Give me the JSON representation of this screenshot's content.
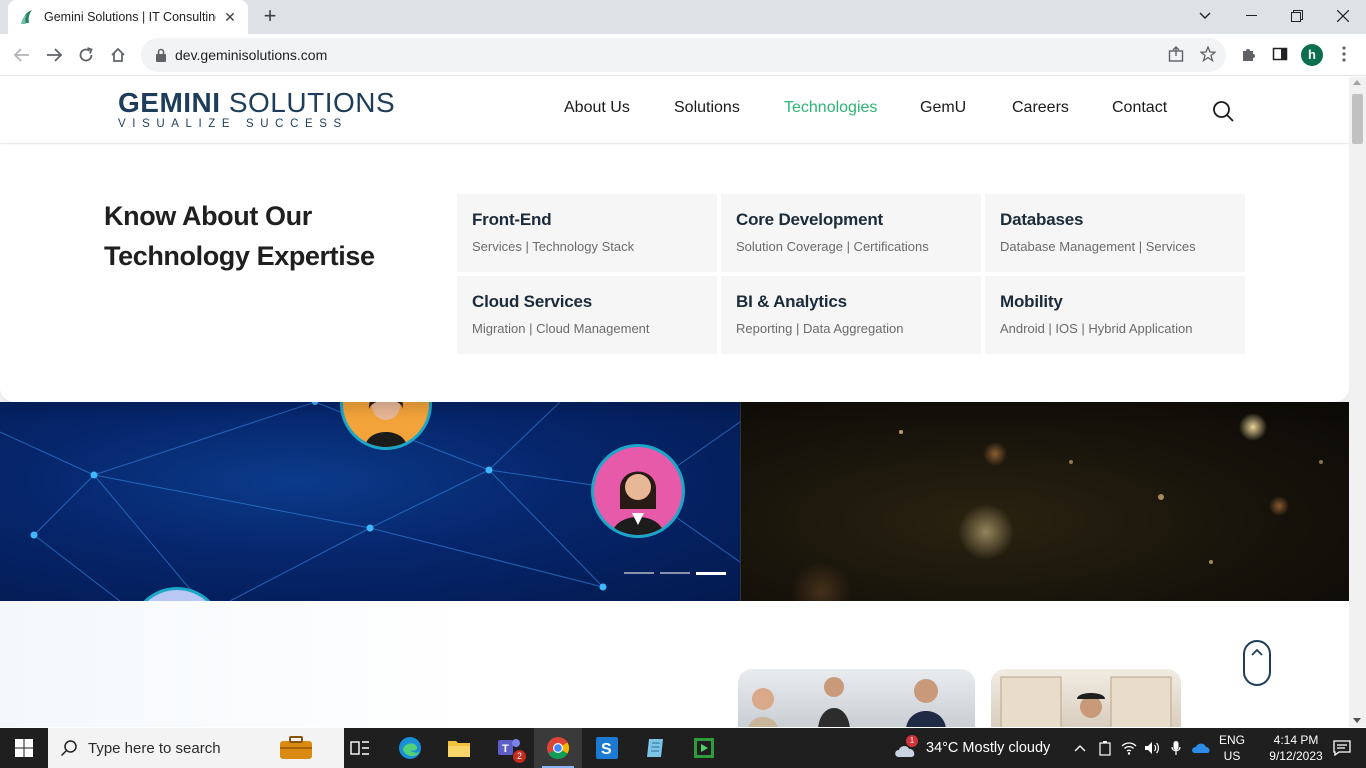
{
  "browser": {
    "tab_title": "Gemini Solutions | IT Consulting,",
    "url": "dev.geminisolutions.com",
    "profile_initial": "h"
  },
  "site": {
    "logo": {
      "brand_bold": "GEMINI",
      "brand_light": "SOLUTIONS",
      "tagline": "VISUALIZE SUCCESS"
    },
    "nav": [
      {
        "label": "About Us"
      },
      {
        "label": "Solutions"
      },
      {
        "label": "Technologies",
        "active": true
      },
      {
        "label": "GemU"
      },
      {
        "label": "Careers"
      },
      {
        "label": "Contact"
      }
    ],
    "mega_menu": {
      "heading": "Know About Our Technology Expertise",
      "cards": [
        {
          "title": "Front-End",
          "subtitle": "Services | Technology Stack"
        },
        {
          "title": "Core Development",
          "subtitle": "Solution Coverage | Certifications"
        },
        {
          "title": "Databases",
          "subtitle": "Database Management | Services"
        },
        {
          "title": "Cloud Services",
          "subtitle": "Migration | Cloud Management"
        },
        {
          "title": "BI & Analytics",
          "subtitle": "Reporting | Data Aggregation"
        },
        {
          "title": "Mobility",
          "subtitle": "Android | IOS | Hybrid Application"
        }
      ]
    },
    "carousel": {
      "slides": 3,
      "active_slide": 3
    }
  },
  "taskbar": {
    "search_placeholder": "Type here to search",
    "teams_badge": "2",
    "weather_badge": "1",
    "weather": "34°C  Mostly cloudy",
    "lang": "ENG",
    "region": "US",
    "time": "4:14 PM",
    "date": "9/12/2023"
  },
  "colors": {
    "accent_green": "#2bb673",
    "brand_navy": "#1e3d5a",
    "hero_blue": "#06256b"
  }
}
